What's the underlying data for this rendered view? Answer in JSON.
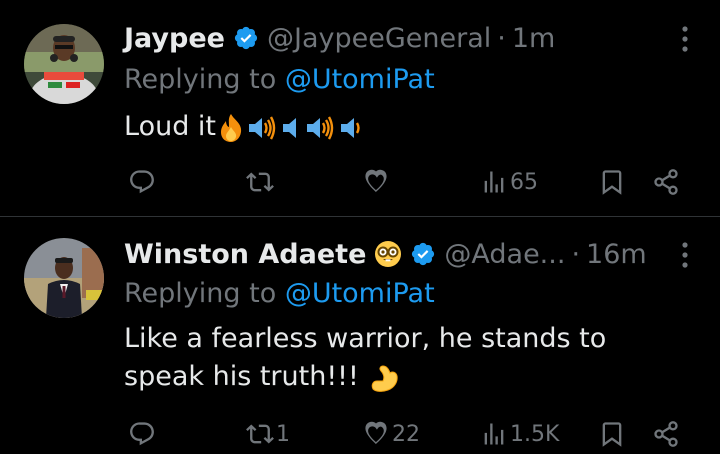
{
  "tweets": [
    {
      "name": "Jaypee",
      "handle": "@JaypeeGeneral",
      "separator": "·",
      "time": "1m",
      "replying_prefix": "Replying to ",
      "replying_to": "@UtomiPat",
      "text": "Loud it",
      "emojis": [
        "fire-emoji",
        "speaker-high-volume-emoji",
        "speaker-low-volume-emoji",
        "speaker-high-volume-emoji",
        "speaker-medium-volume-emoji"
      ],
      "verified": true,
      "actions": {
        "reply": "",
        "retweet": "",
        "like": "",
        "views": "65"
      }
    },
    {
      "name": "Winston Adaete",
      "name_emoji": "nerd-face-emoji",
      "handle": "@Adae...",
      "separator": "·",
      "time": "16m",
      "replying_prefix": "Replying to ",
      "replying_to": "@UtomiPat",
      "text": "Like a fearless warrior, he stands to speak his truth!!!",
      "emojis": [
        "flexed-biceps-emoji"
      ],
      "verified": true,
      "actions": {
        "reply": "",
        "retweet": "1",
        "like": "22",
        "views": "1.5K"
      }
    }
  ],
  "colors": {
    "background": "#000000",
    "text": "#e7e9ea",
    "muted": "#71767b",
    "link": "#1d9bf0",
    "divider": "#2f3336"
  },
  "icons": [
    "reply-icon",
    "retweet-icon",
    "like-icon",
    "views-icon",
    "bookmark-icon",
    "share-icon",
    "more-icon",
    "verified-icon"
  ]
}
